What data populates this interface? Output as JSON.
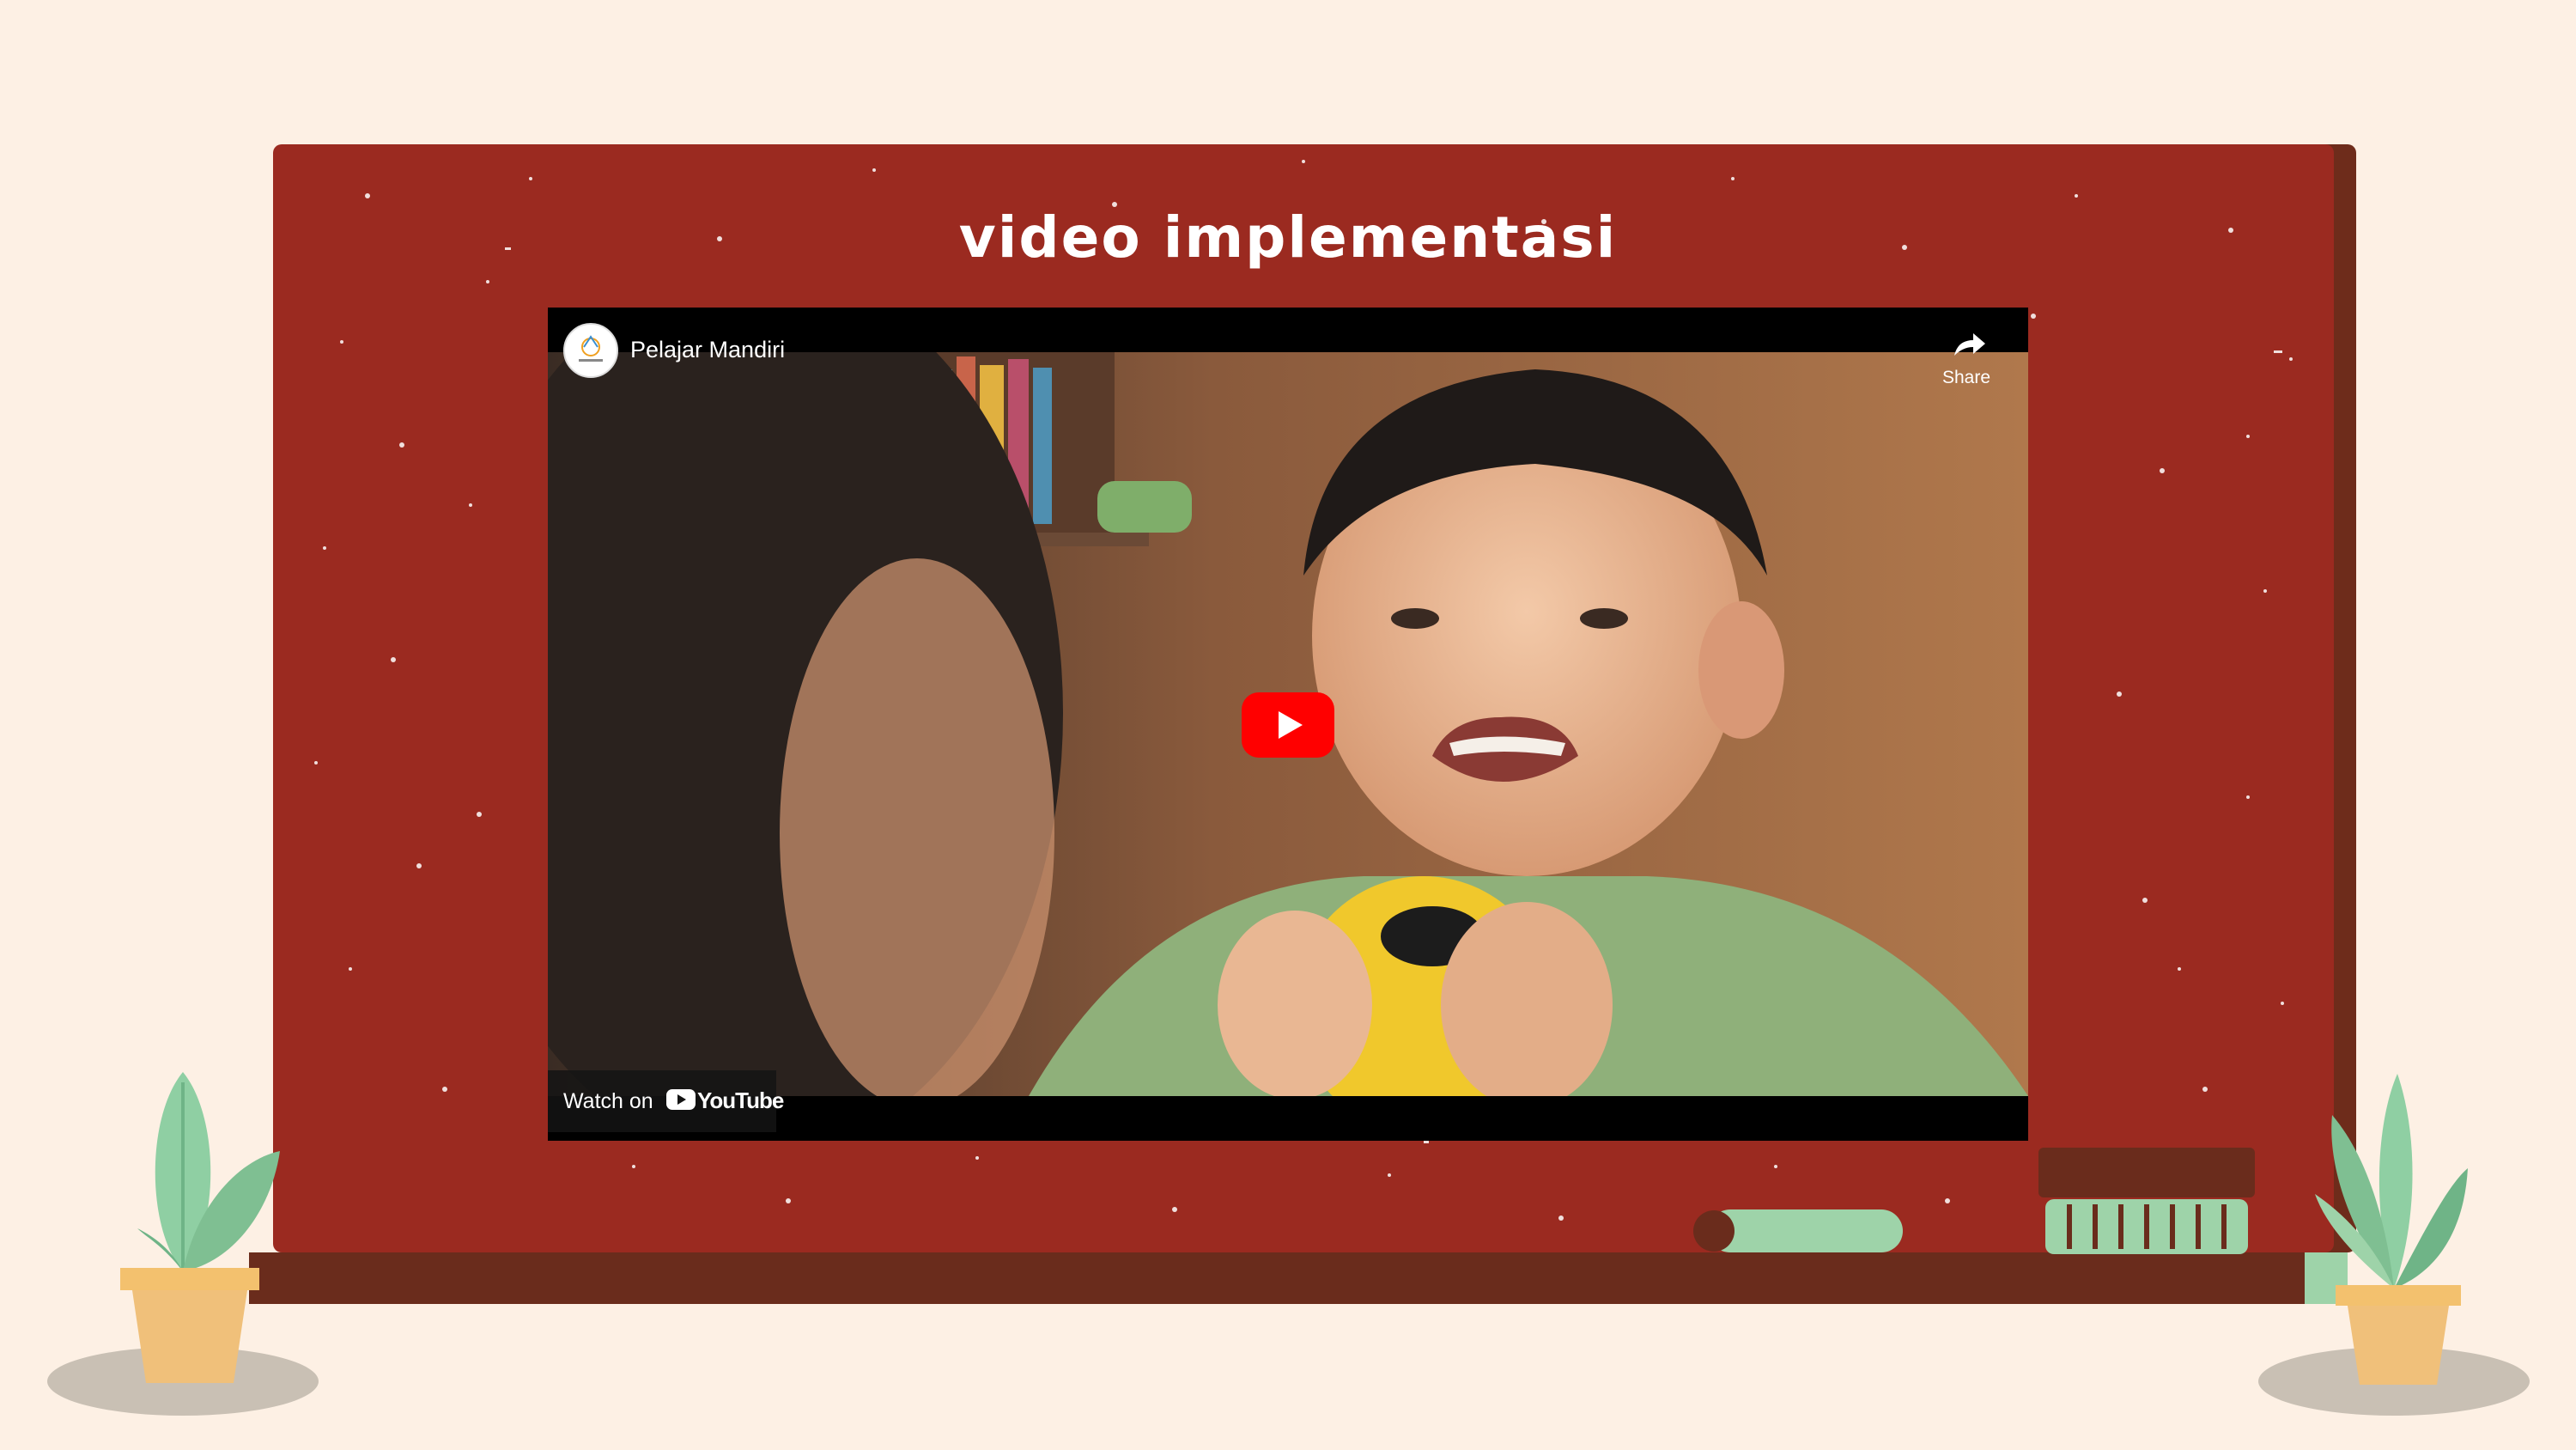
{
  "slide": {
    "title": "video implementasi"
  },
  "video": {
    "channel_name": "Pelajar Mandiri",
    "share_label": "Share",
    "watch_on_label": "Watch on",
    "youtube_label": "YouTube"
  },
  "icons": {
    "play": "play-icon",
    "share": "share-arrow-icon",
    "youtube": "youtube-logo-icon",
    "channel": "channel-avatar-icon"
  },
  "colors": {
    "background": "#fdf0e4",
    "board": "#9b2a20",
    "board_shadow": "#6e2c1b",
    "tray": "#6a2c1c",
    "accent_green": "#9ed3a9",
    "youtube_red": "#ff0000"
  }
}
